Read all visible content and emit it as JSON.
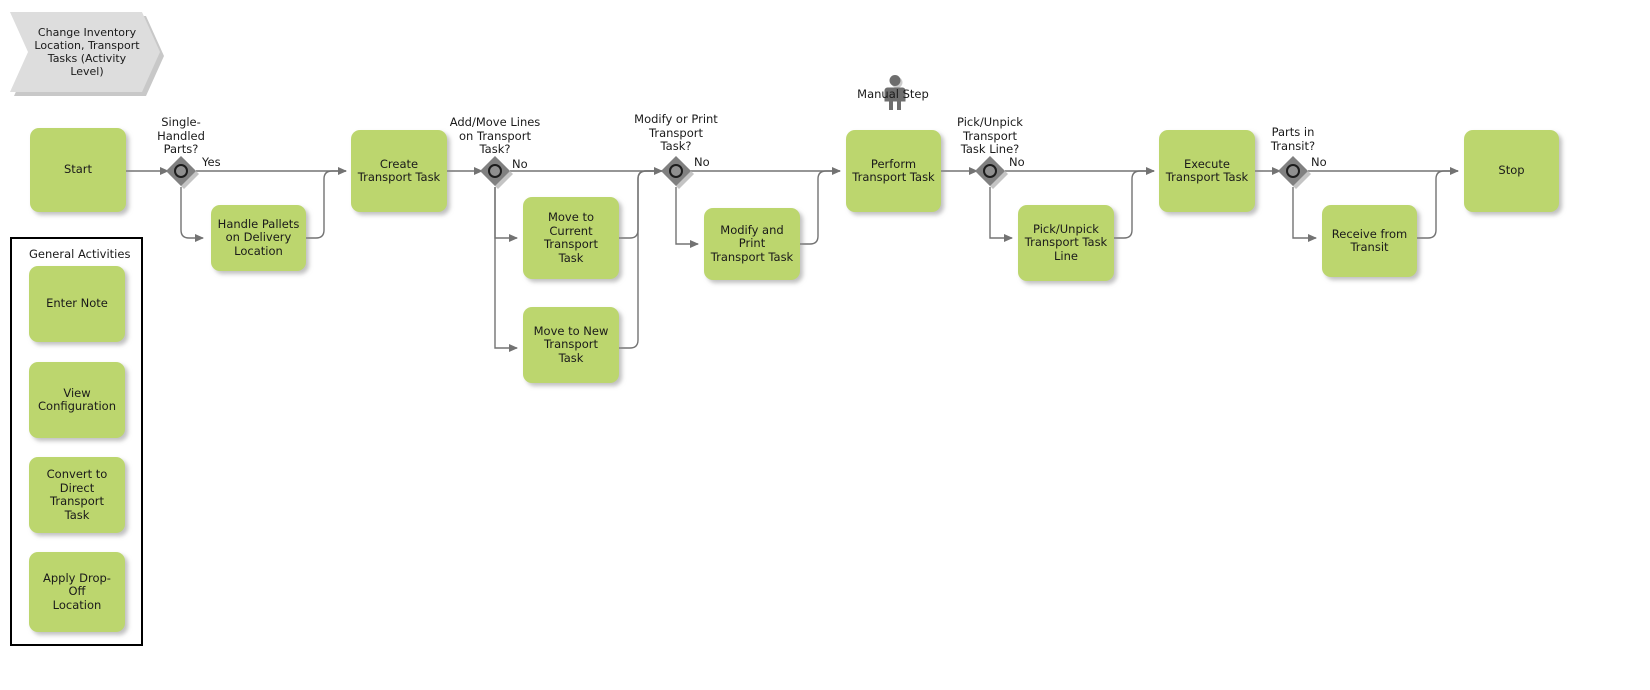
{
  "diagram": {
    "title": "Change Inventory Location, Transport Tasks (Activity Level)",
    "colors": {
      "activity_fill": "#bcd66e",
      "gateway_fill": "#808080",
      "banner_fill": "#dddddd",
      "edge_stroke": "#737373",
      "text": "#1a1a1a"
    }
  },
  "nodes": {
    "start": {
      "label": "Start"
    },
    "handle_pallets": {
      "label": "Handle Pallets\non Delivery\nLocation"
    },
    "create_transport_task": {
      "label": "Create\nTransport Task"
    },
    "move_current": {
      "label": "Move to\nCurrent\nTransport\nTask"
    },
    "move_new": {
      "label": "Move to New\nTransport\nTask"
    },
    "modify_print": {
      "label": "Modify and Print\nTransport Task"
    },
    "perform_transport_task": {
      "label": "Perform\nTransport Task"
    },
    "pick_unpick_line": {
      "label": "Pick/Unpick\nTransport Task\nLine"
    },
    "execute_transport_task": {
      "label": "Execute\nTransport Task"
    },
    "receive_from_transit": {
      "label": "Receive from\nTransit"
    },
    "stop": {
      "label": "Stop"
    }
  },
  "gateways": {
    "single_handled": {
      "caption": "Single-\nHandled\nParts?",
      "yes_label": "Yes"
    },
    "add_move_lines": {
      "caption": "Add/Move Lines\non Transport\nTask?",
      "no_label": "No"
    },
    "modify_or_print": {
      "caption": "Modify or Print\nTransport\nTask?",
      "no_label": "No"
    },
    "pick_unpick": {
      "caption": "Pick/Unpick\nTransport\nTask Line?",
      "no_label": "No"
    },
    "parts_in_transit": {
      "caption": "Parts in\nTransit?",
      "no_label": "No"
    }
  },
  "annotations": {
    "manual_step": {
      "label": "Manual Step",
      "icon": "person-icon"
    }
  },
  "general_activities": {
    "title": "General Activities",
    "items": [
      {
        "label": "Enter Note"
      },
      {
        "label": "View\nConfiguration"
      },
      {
        "label": "Convert to\nDirect Transport\nTask"
      },
      {
        "label": "Apply Drop-Off\nLocation"
      }
    ]
  }
}
